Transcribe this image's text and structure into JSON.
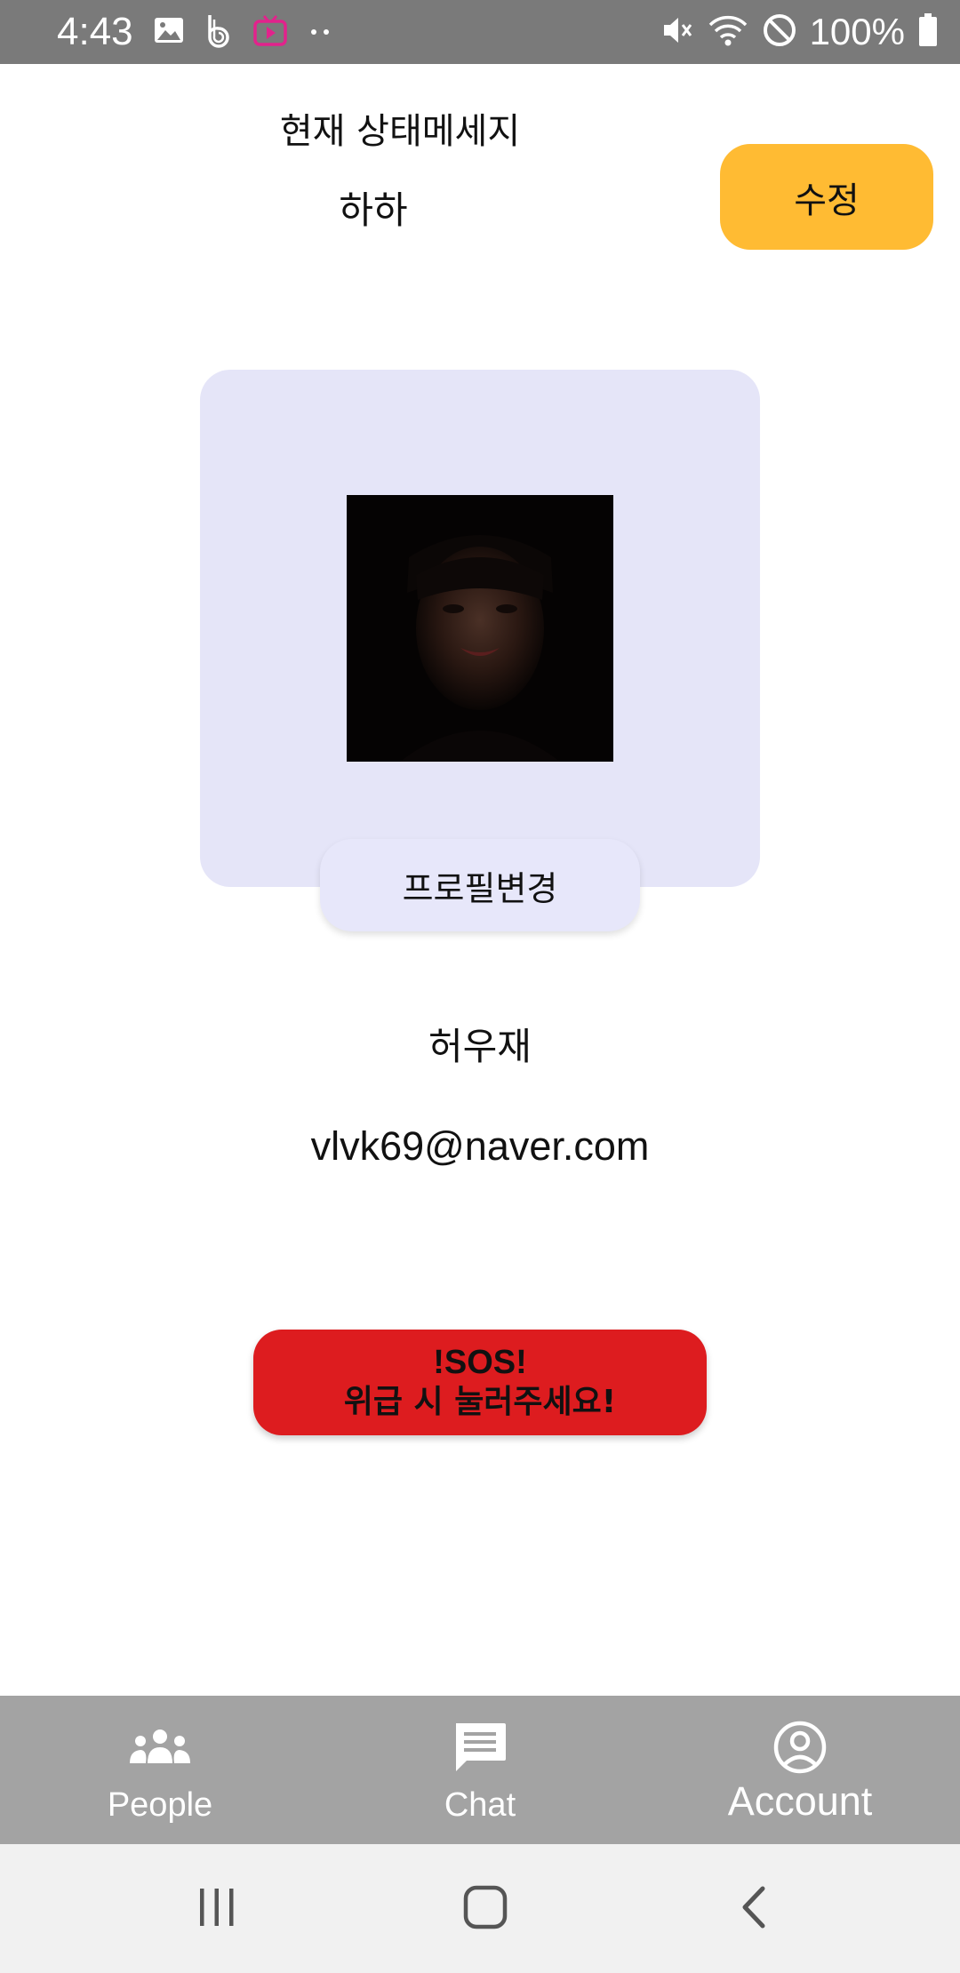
{
  "status_bar": {
    "time": "4:43",
    "battery_text": "100%",
    "left_icons": [
      "image-icon",
      "b-app-icon",
      "tv-app-icon",
      "more-dots-icon"
    ],
    "right_icons": [
      "mute-icon",
      "wifi-icon",
      "do-not-disturb-icon",
      "battery-icon"
    ]
  },
  "status": {
    "label": "현재 상태메세지",
    "message": "하하",
    "edit_button_label": "수정"
  },
  "profile": {
    "change_button_label": "프로필변경",
    "name": "허우재",
    "email": "vlvk69@naver.com"
  },
  "sos": {
    "title": "!SOS!",
    "subtitle": "위급 시 눌러주세요!"
  },
  "bottom_nav": {
    "items": [
      {
        "label": "People",
        "icon": "people-icon"
      },
      {
        "label": "Chat",
        "icon": "chat-icon"
      },
      {
        "label": "Account",
        "icon": "account-icon"
      }
    ],
    "active": "Account"
  },
  "system_nav": {
    "buttons": [
      "recent-apps-icon",
      "home-icon",
      "back-icon"
    ]
  },
  "colors": {
    "status_bar": "#7a7a7a",
    "edit_button": "#ffbb33",
    "profile_card": "#e5e5f8",
    "sos_button": "#dd1c1f",
    "bottom_nav": "#a3a3a3",
    "system_nav": "#f1f1f1"
  }
}
